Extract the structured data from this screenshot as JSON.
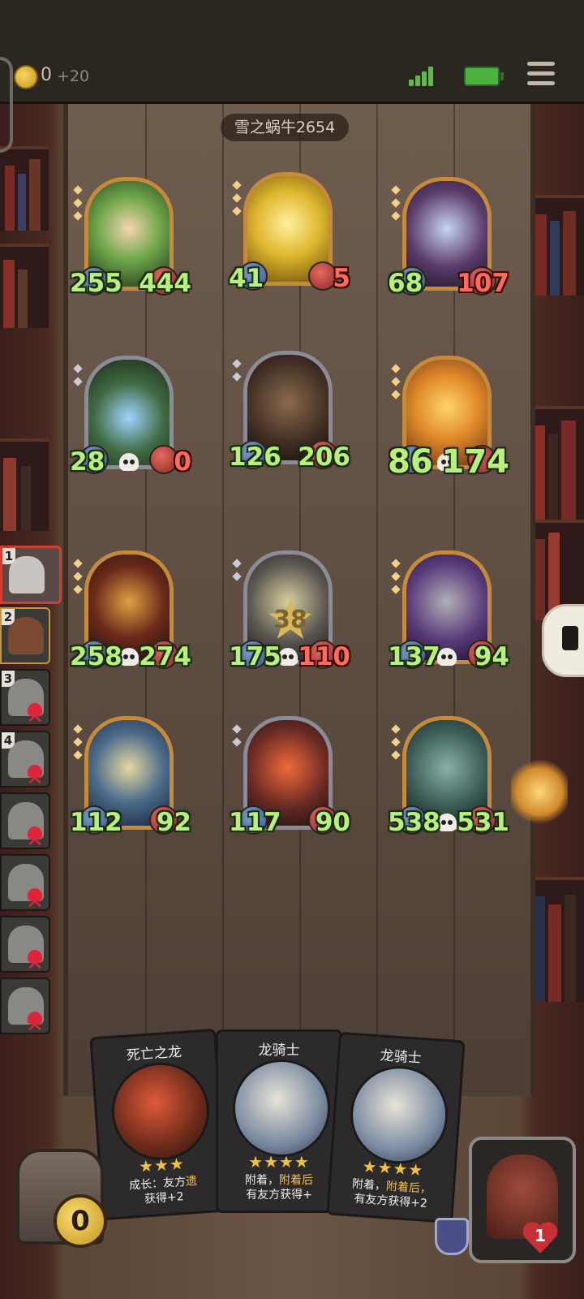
{
  "hud": {
    "gold": "0",
    "gold_bonus": "+20"
  },
  "player": {
    "name": "雪之蜗牛2654"
  },
  "board": {
    "minions": [
      {
        "name": "sprout-girl",
        "atk": "255",
        "hp": "444",
        "frame": "gold",
        "skull": false
      },
      {
        "name": "golden-dragon",
        "atk": "41",
        "hp": "5",
        "frame": "gold",
        "skull": false,
        "hp_red": true
      },
      {
        "name": "elf-sorceress",
        "atk": "68",
        "hp": "107",
        "frame": "gold",
        "skull": false,
        "hp_red": true
      },
      {
        "name": "crystal-flower",
        "atk": "28",
        "hp": "0",
        "frame": "silver",
        "skull": true,
        "hp_red": true
      },
      {
        "name": "totem-golem",
        "atk": "126",
        "hp": "206",
        "frame": "silver",
        "skull": false
      },
      {
        "name": "pumpkin-imp",
        "atk": "86",
        "hp": "174",
        "frame": "gold",
        "skull": true,
        "big": true
      },
      {
        "name": "shadow-dragon",
        "atk": "258",
        "hp": "274",
        "frame": "gold",
        "skull": true
      },
      {
        "name": "robot-knight",
        "atk": "175",
        "hp": "110",
        "frame": "silver",
        "skull": true,
        "hp_red": true,
        "damage": "38"
      },
      {
        "name": "box-robot",
        "atk": "137",
        "hp": "94",
        "frame": "gold",
        "skull": true
      },
      {
        "name": "dragon-knight-armored",
        "atk": "112",
        "hp": "92",
        "frame": "gold",
        "skull": false
      },
      {
        "name": "fire-warrior",
        "atk": "117",
        "hp": "90",
        "frame": "silver",
        "skull": false
      },
      {
        "name": "iron-golem",
        "atk": "538",
        "hp": "531",
        "frame": "gold",
        "skull": true
      }
    ]
  },
  "opponents": [
    {
      "rank": "1",
      "active": true,
      "dead": false
    },
    {
      "rank": "2",
      "active": false,
      "dead": false
    },
    {
      "rank": "3",
      "active": false,
      "dead": true
    },
    {
      "rank": "4",
      "active": false,
      "dead": true
    },
    {
      "rank": "",
      "active": false,
      "dead": true
    },
    {
      "rank": "",
      "active": false,
      "dead": true
    },
    {
      "rank": "",
      "active": false,
      "dead": true
    },
    {
      "rank": "",
      "active": false,
      "dead": true
    }
  ],
  "hand": [
    {
      "title": "死亡之龙",
      "stars": "★★★",
      "desc_a": "成长：友方",
      "desc_hl": "遗",
      "desc_b": "获得+2"
    },
    {
      "title": "龙骑士",
      "stars": "★★★★",
      "desc_a": "附着，",
      "desc_hl": "附着后",
      "desc_b": "有友方获得+"
    },
    {
      "title": "龙骑士",
      "stars": "★★★★",
      "desc_a": "附着，",
      "desc_hl": "附着后，",
      "desc_b": "有友方获得+2"
    }
  ],
  "chest": {
    "value": "0"
  },
  "hero": {
    "health": "1"
  },
  "colors": {
    "gold_frame": "#c58a3a",
    "silver_frame": "#8b8c97",
    "stat_green": "#b7f07b",
    "stat_red": "#ff6b5a"
  }
}
